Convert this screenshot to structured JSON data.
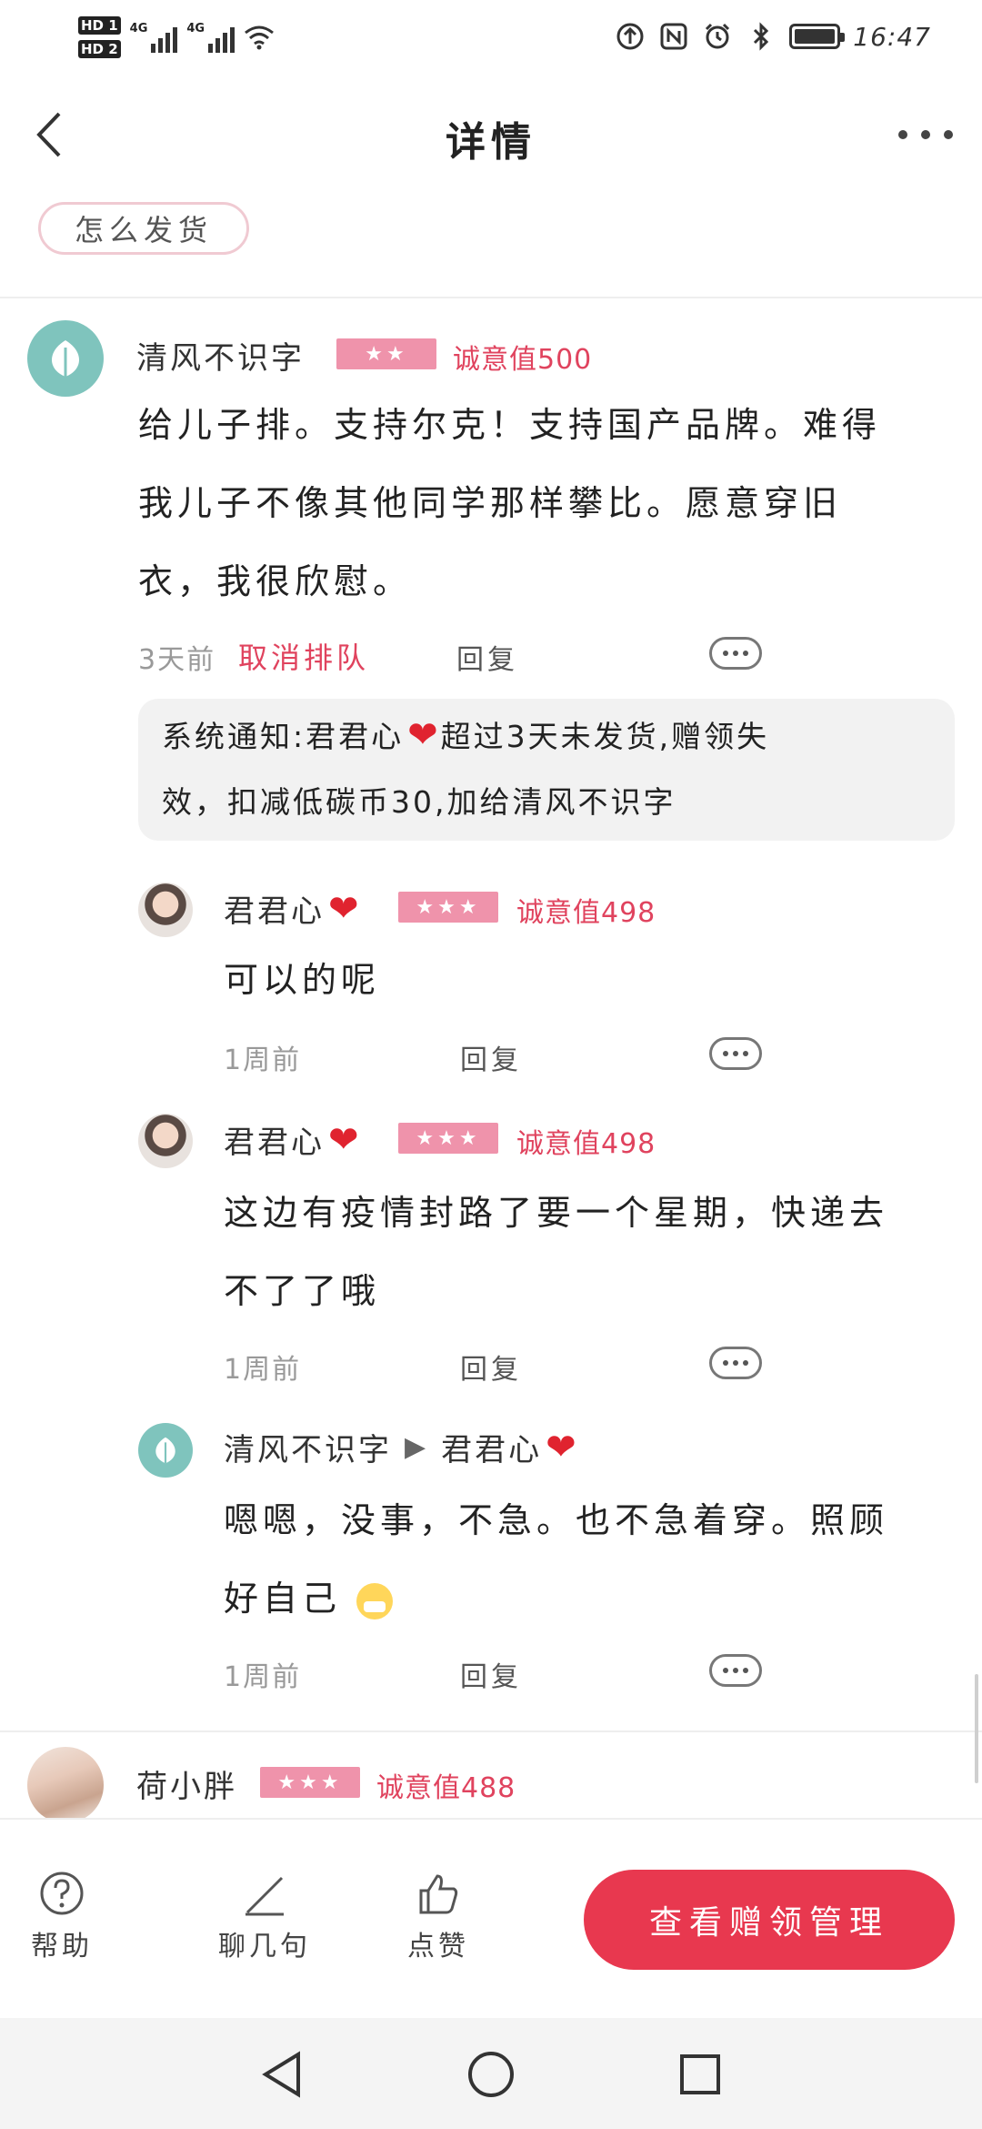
{
  "status_bar": {
    "sim1": "HD 1",
    "sim2": "HD 2",
    "net1": "4G",
    "net2": "4G",
    "time": "16:47",
    "battery_level": 0.9
  },
  "nav": {
    "title": "详情"
  },
  "chip": "怎么发货",
  "main_comment": {
    "user": "清风不识字",
    "rank_stars": "★★",
    "sincerity": "诚意值500",
    "lines": [
      "给儿子排。支持尔克！支持国产品牌。难得",
      "我儿子不像其他同学那样攀比。愿意穿旧",
      "衣，我很欣慰。"
    ],
    "time": "3天前",
    "cancel": "取消排队",
    "reply": "回复"
  },
  "system_notice": {
    "line1_prefix": "系统通知:君君心",
    "line1_suffix": "超过3天未发货,赠领失",
    "line2": "效，扣减低碳币30,加给清风不识字"
  },
  "replies": [
    {
      "user": "君君心",
      "rank_stars": "★★★",
      "sincerity": "诚意值498",
      "lines": [
        "可以的呢"
      ],
      "time": "1周前",
      "reply": "回复"
    },
    {
      "user": "君君心",
      "rank_stars": "★★★",
      "sincerity": "诚意值498",
      "lines": [
        "这边有疫情封路了要一个星期，快递去",
        "不了了哦"
      ],
      "time": "1周前",
      "reply": "回复"
    },
    {
      "user": "清风不识字",
      "to_user": "君君心",
      "lines": [
        "嗯嗯，没事，不急。也不急着穿。照顾",
        "好自己"
      ],
      "time": "1周前",
      "reply": "回复"
    }
  ],
  "next_comment": {
    "user": "荷小胖",
    "rank_stars": "★★★",
    "sincerity": "诚意值488"
  },
  "action_bar": {
    "help": "帮助",
    "chat": "聊几句",
    "like": "点赞",
    "manage": "查看赠领管理"
  },
  "colors": {
    "accent": "#e8384f",
    "sincerity_text": "#e0435e",
    "star_badge": "#ef93ab",
    "heart": "#e0232f"
  }
}
